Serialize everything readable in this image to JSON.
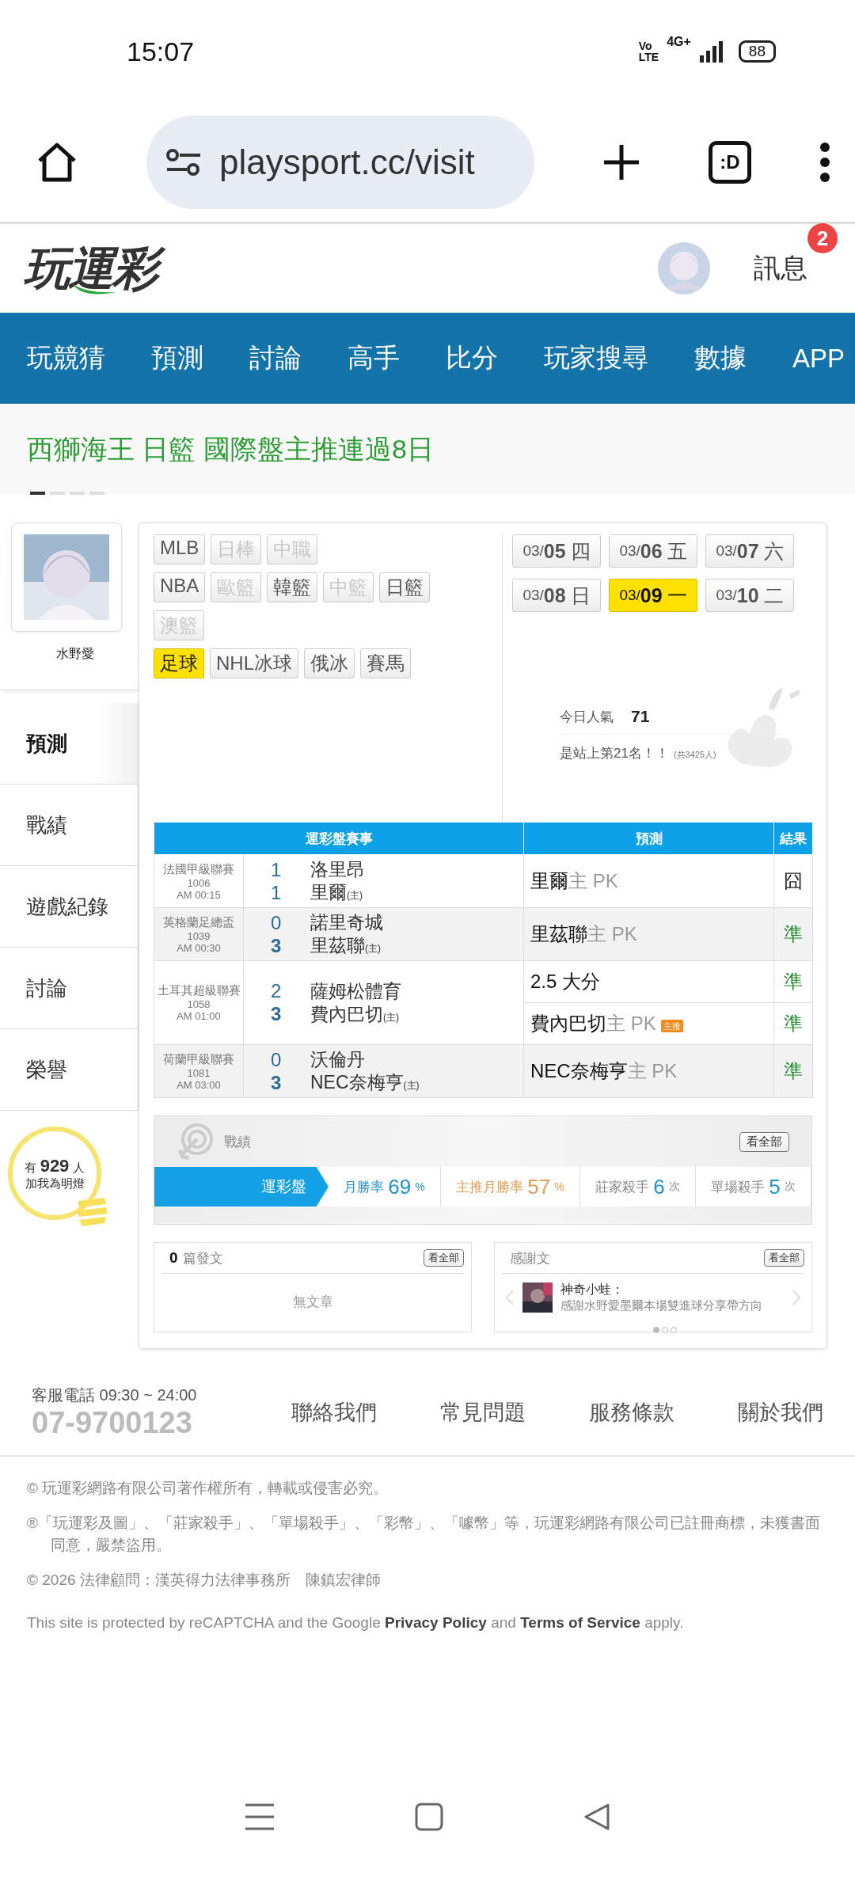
{
  "status_bar": {
    "time": "15:07",
    "volte": [
      "Vo",
      "LTE"
    ],
    "network": "4G+",
    "battery": "88"
  },
  "browser": {
    "url": "playsport.cc/visit",
    "tab_label": ":D"
  },
  "header": {
    "logo": "玩運彩",
    "messages": {
      "label": "訊息",
      "badge": "2"
    }
  },
  "nav": [
    "玩競猜",
    "預測",
    "討論",
    "高手",
    "比分",
    "玩家搜尋",
    "數據",
    "APP"
  ],
  "ticker": {
    "text": "西獅海王 日籃 國際盤主推連過8日",
    "dots": [
      {
        "selected": true
      },
      {
        "selected": false
      },
      {
        "selected": false
      },
      {
        "selected": false
      }
    ]
  },
  "profile": {
    "name": "水野愛"
  },
  "side_menu": [
    {
      "label": "預測",
      "selected": true
    },
    {
      "label": "戰績",
      "selected": false
    },
    {
      "label": "遊戲紀錄",
      "selected": false
    },
    {
      "label": "討論",
      "selected": false
    },
    {
      "label": "榮譽",
      "selected": false
    }
  ],
  "fans": {
    "prefix": "有",
    "count": "929",
    "suffix": "人",
    "caption": "加我為明燈"
  },
  "league_tag_rows": [
    [
      {
        "label": "MLB",
        "selected": false,
        "disabled": false
      },
      {
        "label": "日棒",
        "selected": false,
        "disabled": true
      },
      {
        "label": "中職",
        "selected": false,
        "disabled": true
      }
    ],
    [
      {
        "label": "NBA",
        "selected": false,
        "disabled": false
      },
      {
        "label": "歐籃",
        "selected": false,
        "disabled": true
      },
      {
        "label": "韓籃",
        "selected": false,
        "disabled": false
      },
      {
        "label": "中籃",
        "selected": false,
        "disabled": true
      },
      {
        "label": "日籃",
        "selected": false,
        "disabled": false
      }
    ],
    [
      {
        "label": "澳籃",
        "selected": false,
        "disabled": true
      }
    ],
    [
      {
        "label": "足球",
        "selected": true,
        "disabled": false
      },
      {
        "label": "NHL冰球",
        "selected": false,
        "disabled": false
      },
      {
        "label": "俄冰",
        "selected": false,
        "disabled": false
      },
      {
        "label": "賽馬",
        "selected": false,
        "disabled": false
      }
    ]
  ],
  "dates": [
    {
      "month": "03/",
      "day": "05",
      "weekday": "四",
      "selected": false
    },
    {
      "month": "03/",
      "day": "06",
      "weekday": "五",
      "selected": false
    },
    {
      "month": "03/",
      "day": "07",
      "weekday": "六",
      "selected": false
    },
    {
      "month": "03/",
      "day": "08",
      "weekday": "日",
      "selected": false
    },
    {
      "month": "03/",
      "day": "09",
      "weekday": "一",
      "selected": true
    },
    {
      "month": "03/",
      "day": "10",
      "weekday": "二",
      "selected": false
    }
  ],
  "popularity": {
    "label": "今日人氣",
    "value": "71",
    "rank": "是站上第21名！！",
    "total": "(共3425人)"
  },
  "table": {
    "columns": [
      "運彩盤賽事",
      "預測",
      "結果"
    ],
    "matches": [
      {
        "league": "法國甲級聯賽",
        "code": "1006",
        "time": "AM 00:15",
        "teams": [
          {
            "score": "1",
            "name": "洛里昂",
            "winner": false
          },
          {
            "score": "1",
            "name": "里爾",
            "home_mark": "(主)",
            "winner": false
          }
        ],
        "predictions": [
          {
            "pick": "里爾",
            "side": "主",
            "line": "PK",
            "result": "囧",
            "kind": "miss"
          }
        ]
      },
      {
        "league": "英格蘭足總盃",
        "code": "1039",
        "time": "AM 00:30",
        "teams": [
          {
            "score": "0",
            "name": "諾里奇城",
            "winner": false
          },
          {
            "score": "3",
            "name": "里茲聯",
            "home_mark": "(主)",
            "winner": true
          }
        ],
        "predictions": [
          {
            "pick": "里茲聯",
            "side": "主",
            "line": "PK",
            "result": "準",
            "kind": "hit"
          }
        ]
      },
      {
        "league": "土耳其超級聯賽",
        "code": "1058",
        "time": "AM 01:00",
        "teams": [
          {
            "score": "2",
            "name": "薩姆松體育",
            "winner": false
          },
          {
            "score": "3",
            "name": "費內巴切",
            "home_mark": "(主)",
            "winner": true
          }
        ],
        "predictions": [
          {
            "pick": "2.5 大分",
            "result": "準",
            "kind": "hit"
          },
          {
            "pick": "費內巴切",
            "side": "主",
            "line": "PK",
            "badge": "主推",
            "result": "準",
            "kind": "hit"
          }
        ]
      },
      {
        "league": "荷蘭甲級聯賽",
        "code": "1081",
        "time": "AM 03:00",
        "teams": [
          {
            "score": "0",
            "name": "沃倫丹",
            "winner": false
          },
          {
            "score": "3",
            "name": "NEC奈梅亨",
            "home_mark": "(主)",
            "winner": true
          }
        ],
        "predictions": [
          {
            "pick": "NEC奈梅亨",
            "side": "主",
            "line": "PK",
            "result": "準",
            "kind": "hit"
          }
        ]
      }
    ]
  },
  "stats": {
    "title": "戰績",
    "view_all": "看全部",
    "tab": "運彩盤",
    "items": [
      {
        "label": "月勝率",
        "value": "69",
        "unit": "%",
        "kind": "rate"
      },
      {
        "label": "主推月勝率",
        "value": "57",
        "unit": "%",
        "kind": "featured"
      },
      {
        "label": "莊家殺手",
        "value": "6",
        "unit": "次",
        "kind": "count"
      },
      {
        "label": "單場殺手",
        "value": "5",
        "unit": "次",
        "kind": "count"
      }
    ]
  },
  "posts": {
    "count": "0",
    "label": "篇發文",
    "view_all": "看全部",
    "empty": "無文章"
  },
  "thanks": {
    "title": "感謝文",
    "view_all": "看全部",
    "author": "神奇小蛙：",
    "text": "感謝水野愛墨爾本場雙進球分享帶方向",
    "dots": [
      {
        "selected": true
      },
      {
        "selected": false
      },
      {
        "selected": false
      }
    ]
  },
  "footer": {
    "hotline": "客服電話 09:30 ~ 24:00",
    "phone": "07-9700123",
    "links": [
      "聯絡我們",
      "常見問題",
      "服務條款",
      "關於我們"
    ]
  },
  "legal": {
    "copyright": "© 玩運彩網路有限公司著作權所有，轉載或侵害必究。",
    "trademark": "®「玩運彩及圖」、「莊家殺手」、「單場殺手」、「彩幣」、「噱幣」等，玩運彩網路有限公司已註冊商標，未獲書面同意，嚴禁盜用。",
    "counsel": "© 2026 法律顧問：漢英得力法律事務所　陳鎮宏律師",
    "recaptcha": "This site is protected by reCAPTCHA and the Google **Privacy Policy** and **Terms of Service** apply."
  }
}
